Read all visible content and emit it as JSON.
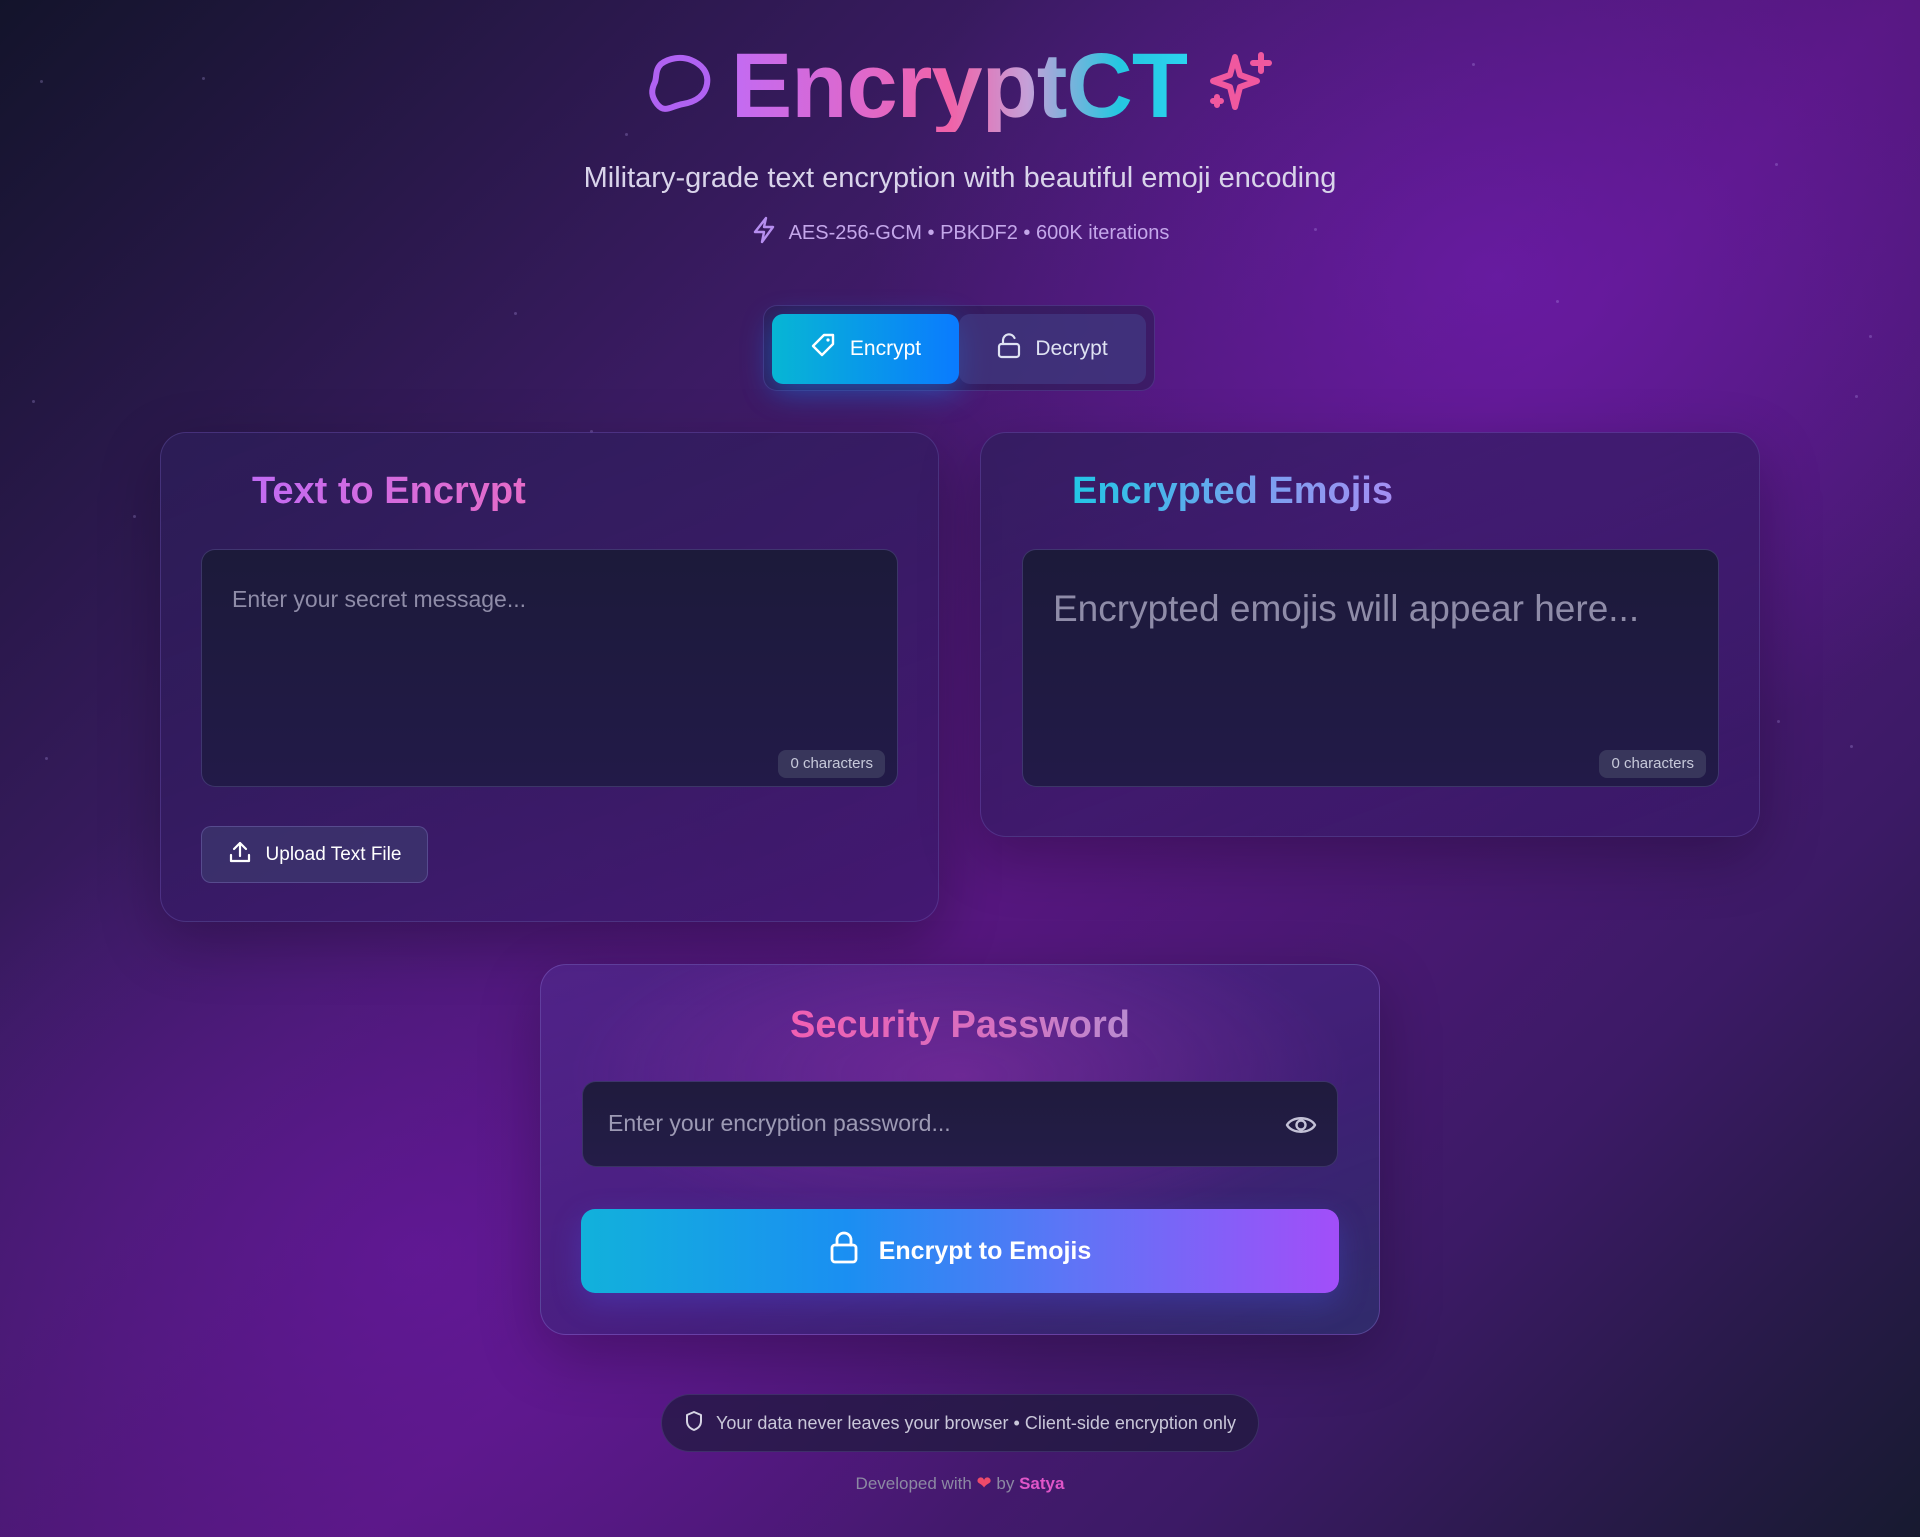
{
  "header": {
    "title": "EncryptCT",
    "subtitle": "Military-grade text encryption with beautiful emoji encoding",
    "tagline": "AES-256-GCM • PBKDF2 • 600K iterations"
  },
  "mode_toggle": {
    "encrypt_label": "Encrypt",
    "decrypt_label": "Decrypt",
    "active": "Encrypt"
  },
  "input_panel": {
    "title": "Text to Encrypt",
    "placeholder": "Enter your secret message...",
    "char_count": "0 characters",
    "upload_label": "Upload Text File"
  },
  "output_panel": {
    "title": "Encrypted Emojis",
    "placeholder": "Encrypted emojis will appear here...",
    "char_count": "0 characters"
  },
  "password_panel": {
    "title": "Security Password",
    "placeholder": "Enter your encryption password...",
    "submit_label": "Encrypt to Emojis"
  },
  "footer": {
    "notice": "Your data never leaves your browser • Client-side encryption only",
    "credit_prefix": "Developed with",
    "credit_by": "by",
    "author": "Satya"
  },
  "colors": {
    "accent_cyan": "#07b6d4",
    "accent_blue": "#0a7bff",
    "accent_purple": "#a24ef9",
    "accent_pink": "#f062a8",
    "background": "#3a1b62"
  },
  "icons": {
    "logo": "brain-outline-icon",
    "title_decoration": "sparkles-icon",
    "tagline": "zap-icon",
    "encrypt_tab": "tag-icon",
    "decrypt_tab": "unlock-icon",
    "upload": "upload-icon",
    "password_toggle": "eye-icon",
    "submit": "lock-icon",
    "notice": "shield-icon",
    "credit": "heart-icon"
  }
}
